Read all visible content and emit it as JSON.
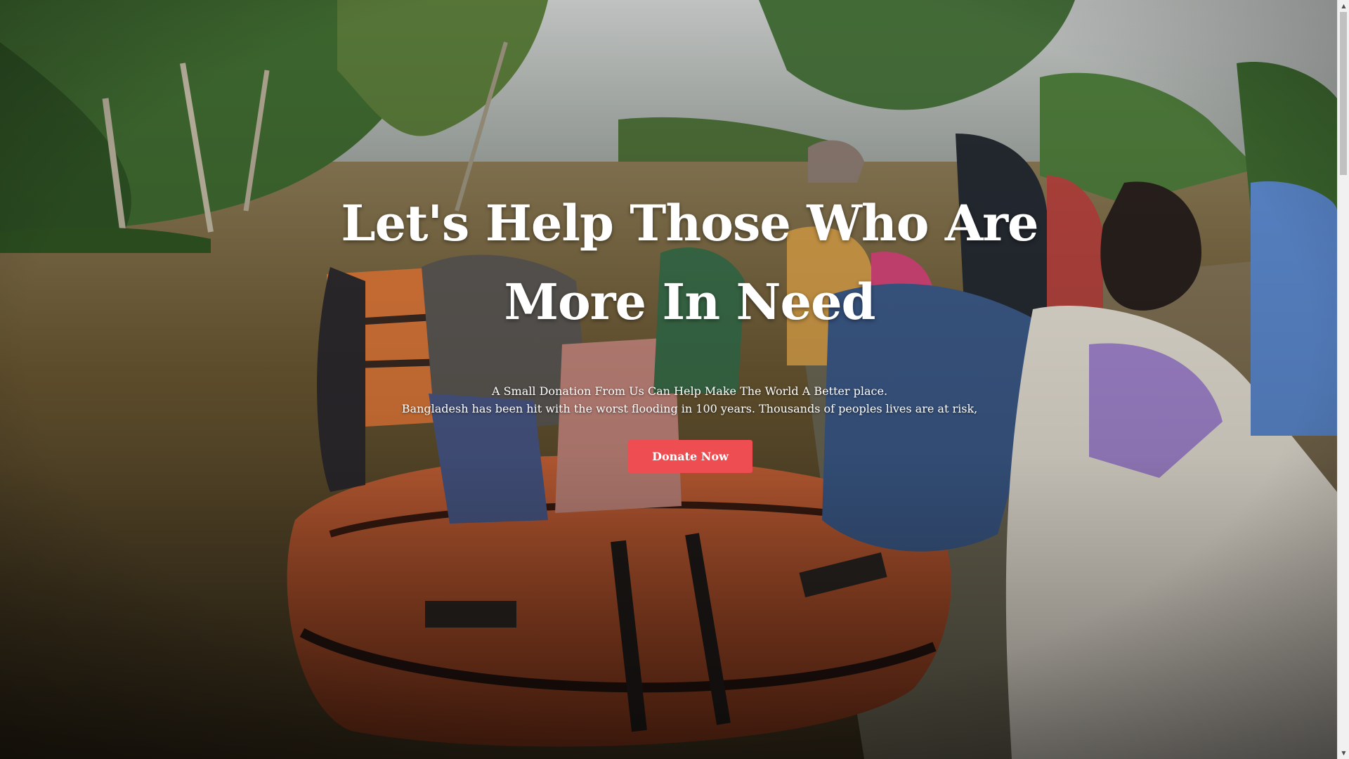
{
  "hero": {
    "headline": "Let's Help Those Who Are More In Need",
    "subtitle_line1": "A Small Donation From Us Can Help Make The World A Better place.",
    "subtitle_line2": "Bangladesh has been hit with the worst flooding in 100 years. Thousands of peoples lives are at risk,",
    "cta_label": "Donate Now"
  },
  "colors": {
    "cta_background": "#ee4d52",
    "text": "#ffffff"
  },
  "scrollbar": {
    "up_icon": "arrow-up-icon",
    "down_icon": "arrow-down-icon"
  }
}
